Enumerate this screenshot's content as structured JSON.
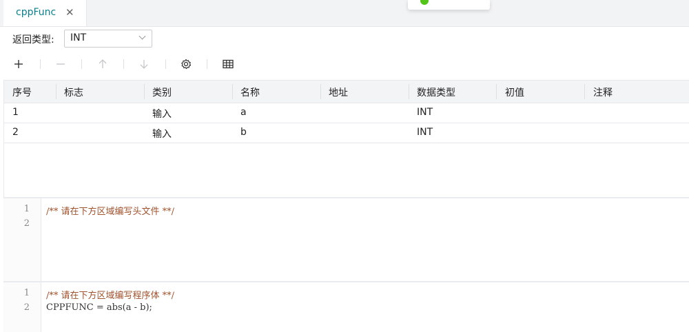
{
  "tab": {
    "label": "cppFunc",
    "close": "✕"
  },
  "return_type": {
    "label": "返回类型:",
    "value": "INT"
  },
  "table": {
    "columns": [
      "序号",
      "标志",
      "类别",
      "名称",
      "地址",
      "数据类型",
      "初值",
      "注释"
    ],
    "rows": [
      [
        "1",
        "",
        "输入",
        "a",
        "",
        "INT",
        "",
        ""
      ],
      [
        "2",
        "",
        "输入",
        "b",
        "",
        "INT",
        "",
        ""
      ]
    ]
  },
  "toolbar": {
    "icons": [
      "plus-icon",
      "minus-icon",
      "arrow-up-icon",
      "arrow-down-icon",
      "gear-icon",
      "table-icon"
    ],
    "enabled": {
      "plus": true,
      "minus": false,
      "up": false,
      "down": false,
      "settings": true,
      "table": true
    }
  },
  "header_editor": {
    "line_numbers": [
      "1",
      "2"
    ],
    "lines": [
      "/** 请在下方区域编写头文件 **/",
      ""
    ]
  },
  "body_editor": {
    "line_numbers": [
      "1",
      "2"
    ],
    "lines": [
      "/** 请在下方区域编写程序体 **/",
      "CPPFUNC = abs(a - b);"
    ]
  },
  "colors": {
    "accent": "#0a7e8c",
    "comment": "#a0522d",
    "toast_success": "#52c41a"
  }
}
